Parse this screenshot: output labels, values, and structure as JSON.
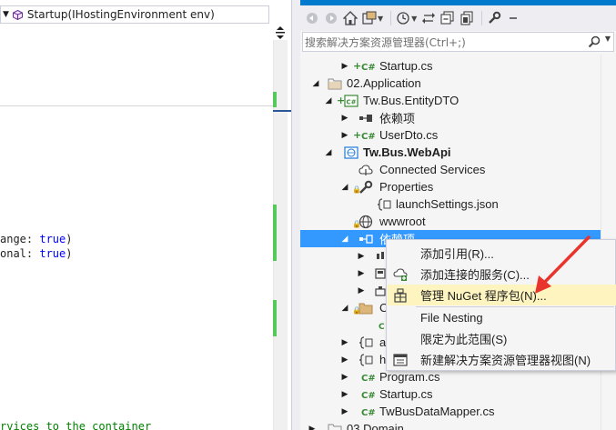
{
  "editor": {
    "nav_dropdown_text": "Startup(IHostingEnvironment env)",
    "code_lines": [
      {
        "prefix": "ange: ",
        "keyword": "true",
        "suffix": ")"
      },
      {
        "prefix": "onal: ",
        "keyword": "true",
        "suffix": ")"
      }
    ],
    "comment_line": "rvices to the container"
  },
  "solution_explorer": {
    "search_placeholder": "搜索解决方案资源管理器(Ctrl+;)",
    "toolbar_icons": [
      "back-icon",
      "forward-icon",
      "home-icon",
      "sync-view-icon",
      "history-icon",
      "pending-changes-icon",
      "collapse-all-icon",
      "show-all-files-icon",
      "properties-wrench-icon"
    ],
    "tree": [
      {
        "label": "Startup.cs",
        "icon": "csharp-file-icon"
      },
      {
        "label": "02.Application",
        "icon": "solution-folder-icon"
      },
      {
        "label": "Tw.Bus.EntityDTO",
        "icon": "csharp-project-icon"
      },
      {
        "label": "依赖项",
        "icon": "dependencies-icon"
      },
      {
        "label": "UserDto.cs",
        "icon": "csharp-file-icon"
      },
      {
        "label": "Tw.Bus.WebApi",
        "icon": "web-project-icon"
      },
      {
        "label": "Connected Services",
        "icon": "connected-services-icon"
      },
      {
        "label": "Properties",
        "icon": "wrench-icon"
      },
      {
        "label": "launchSettings.json",
        "icon": "json-file-icon"
      },
      {
        "label": "wwwroot",
        "icon": "globe-icon"
      },
      {
        "label": "依赖项",
        "icon": "dependencies-icon"
      },
      {
        "label": "Program.cs",
        "icon": "csharp-file-icon"
      },
      {
        "label": "Startup.cs",
        "icon": "csharp-file-icon"
      },
      {
        "label": "TwBusDataMapper.cs",
        "icon": "csharp-file-icon"
      },
      {
        "label": "03.Domain",
        "icon": "solution-folder-icon"
      }
    ],
    "partial_labels": [
      "C",
      "a",
      "h"
    ]
  },
  "context_menu": {
    "items": [
      {
        "label": "添加引用(R)...",
        "icon": ""
      },
      {
        "label": "添加连接的服务(C)...",
        "icon": "connected-service-add-icon"
      },
      {
        "label": "管理 NuGet 程序包(N)...",
        "icon": "nuget-package-icon"
      },
      {
        "label": "File Nesting",
        "icon": ""
      },
      {
        "label": "限定为此范围(S)",
        "icon": ""
      },
      {
        "label": "新建解决方案资源管理器视图(N)",
        "icon": "new-view-icon"
      }
    ]
  },
  "colors": {
    "selection": "#3399ff",
    "menu_hot": "#fdf4bf",
    "annotation_arrow": "#e8342c",
    "change_marker": "#57c95c",
    "keyword": "#0000ff",
    "comment": "#008000"
  }
}
